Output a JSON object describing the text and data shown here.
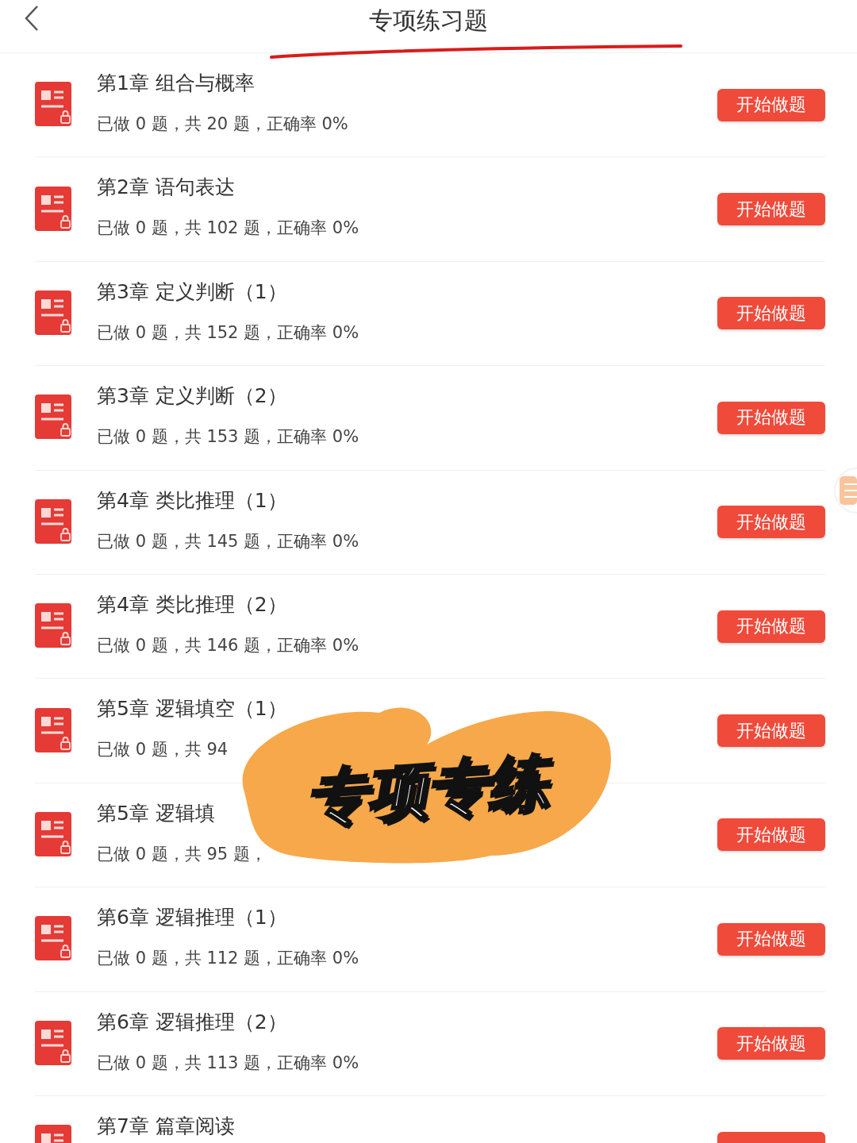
{
  "header": {
    "title": "专项练习题"
  },
  "rows": [
    {
      "title": "第1章 组合与概率",
      "subtitle": "已做 0 题，共 20 题，正确率 0%",
      "button": "开始做题"
    },
    {
      "title": "第2章 语句表达",
      "subtitle": "已做 0 题，共 102 题，正确率 0%",
      "button": "开始做题"
    },
    {
      "title": "第3章 定义判断（1）",
      "subtitle": "已做 0 题，共 152 题，正确率 0%",
      "button": "开始做题"
    },
    {
      "title": "第3章 定义判断（2）",
      "subtitle": "已做 0 题，共 153 题，正确率 0%",
      "button": "开始做题"
    },
    {
      "title": "第4章 类比推理（1）",
      "subtitle": "已做 0 题，共 145 题，正确率 0%",
      "button": "开始做题"
    },
    {
      "title": "第4章 类比推理（2）",
      "subtitle": "已做 0 题，共 146 题，正确率 0%",
      "button": "开始做题"
    },
    {
      "title": "第5章 逻辑填空（1）",
      "subtitle": "已做 0 题，共 94",
      "button": "开始做题"
    },
    {
      "title": "第5章 逻辑填",
      "subtitle": "已做 0 题，共 95 题，",
      "button": "开始做题"
    },
    {
      "title": "第6章 逻辑推理（1）",
      "subtitle": "已做 0 题，共 112 题，正确率 0%",
      "button": "开始做题"
    },
    {
      "title": "第6章 逻辑推理（2）",
      "subtitle": "已做 0 题，共 113 题，正确率 0%",
      "button": "开始做题"
    },
    {
      "title": "第7章 篇章阅读"
    }
  ],
  "sticker": {
    "text": "专项专练"
  }
}
